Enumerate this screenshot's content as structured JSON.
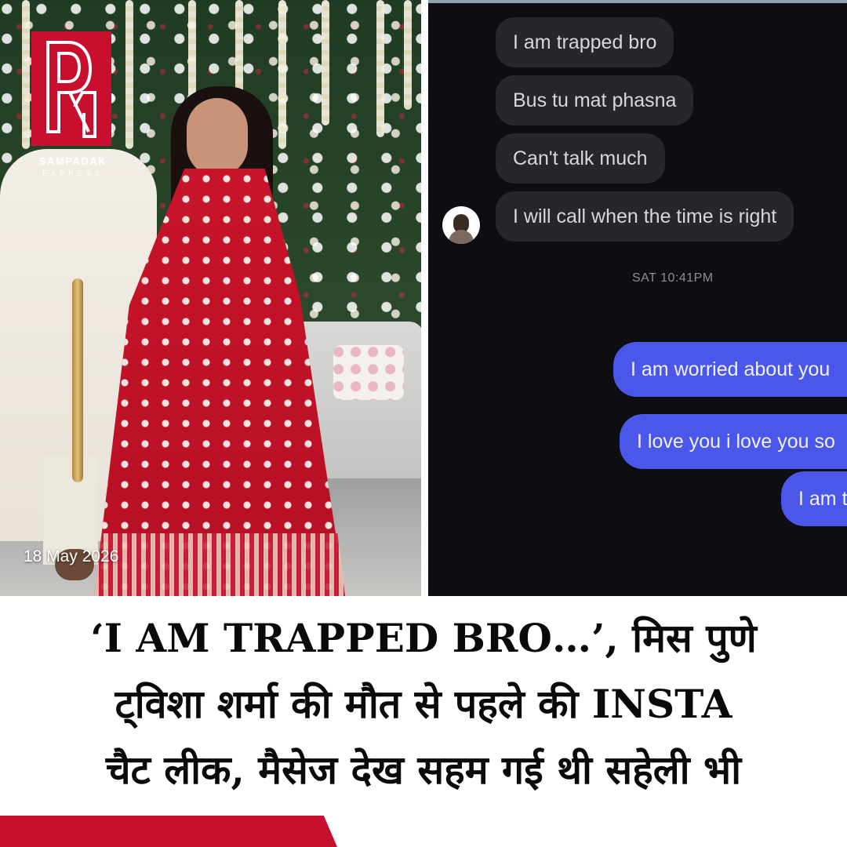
{
  "logo": {
    "name": "SAMPADAK",
    "sub": "EXPRESS",
    "color": "#c8102e"
  },
  "photo": {
    "date": "18 May 2026"
  },
  "chat": {
    "incoming": [
      "I am trapped bro",
      "Bus tu mat phasna",
      "Can't talk much",
      "I will call when the time is right"
    ],
    "timestamp": "SAT 10:41PM",
    "outgoing": [
      "I am worried about you",
      "I love you i love you so",
      "I am t"
    ],
    "colors": {
      "incoming_bubble": "#26272c",
      "outgoing_bubble": "#4a57e8",
      "background": "#0d0d12"
    }
  },
  "headline": {
    "line1": "‘I AM TRAPPED BRO…’, मिस पुणे",
    "line2": "ट्विशा शर्मा की मौत से पहले की INSTA",
    "line3": "चैट लीक, मैसेज देख सहम गई थी सहेली भी"
  }
}
